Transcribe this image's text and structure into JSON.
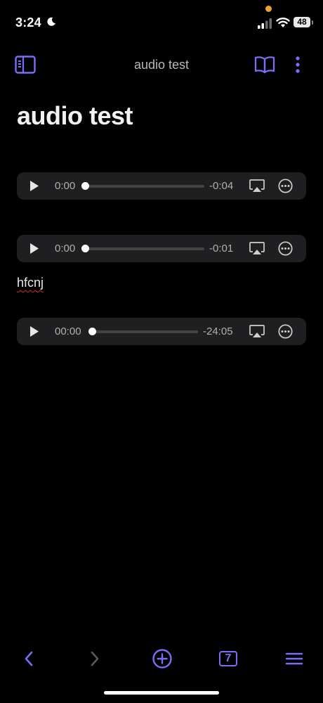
{
  "status_bar": {
    "time": "3:24",
    "battery": "48",
    "icons": [
      "moon-icon",
      "cellular-signal-icon",
      "wifi-icon",
      "battery-icon"
    ]
  },
  "nav": {
    "title": "audio test",
    "left_icon": "sidebar-toggle-icon",
    "right_icons": [
      "reading-view-icon",
      "more-options-icon"
    ]
  },
  "document": {
    "title": "audio test",
    "text": "hfcnj",
    "players": [
      {
        "current": "0:00",
        "remaining": "-0:04"
      },
      {
        "current": "0:00",
        "remaining": "-0:01"
      },
      {
        "current": "00:00",
        "remaining": "-24:05"
      }
    ]
  },
  "bottom_bar": {
    "tabs_count": "7",
    "icons": [
      "back-arrow-icon",
      "forward-arrow-icon",
      "new-note-icon",
      "tabs-icon",
      "menu-icon"
    ]
  },
  "colors": {
    "accent": "#7b6ef6",
    "background": "#000000",
    "player_bg": "#1f1f21"
  }
}
